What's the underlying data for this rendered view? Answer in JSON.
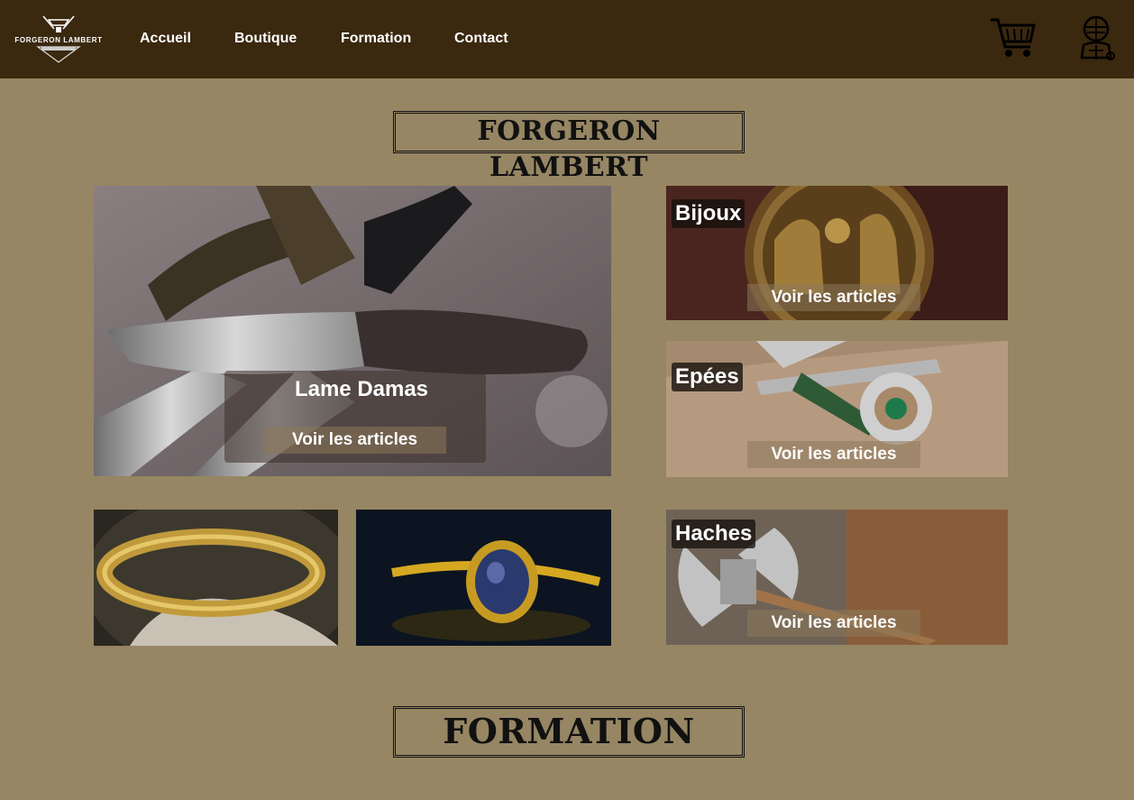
{
  "header": {
    "logo_text": "FORGERON LAMBERT",
    "nav": [
      "Accueil",
      "Boutique",
      "Formation",
      "Contact"
    ],
    "cart_icon": "cart-icon",
    "account_icon": "knight-icon"
  },
  "sections": {
    "title_1": "FORGERON LAMBERT",
    "title_2": "FORMATION"
  },
  "featured": {
    "title": "Lame Damas",
    "cta": "Voir les articles"
  },
  "categories": [
    {
      "label": "Bijoux",
      "cta": "Voir les articles"
    },
    {
      "label": "Epées",
      "cta": "Voir les articles"
    },
    {
      "label": "Haches",
      "cta": "Voir les articles"
    }
  ],
  "colors": {
    "header_bg": "#3a280f",
    "page_bg": "#968663"
  }
}
